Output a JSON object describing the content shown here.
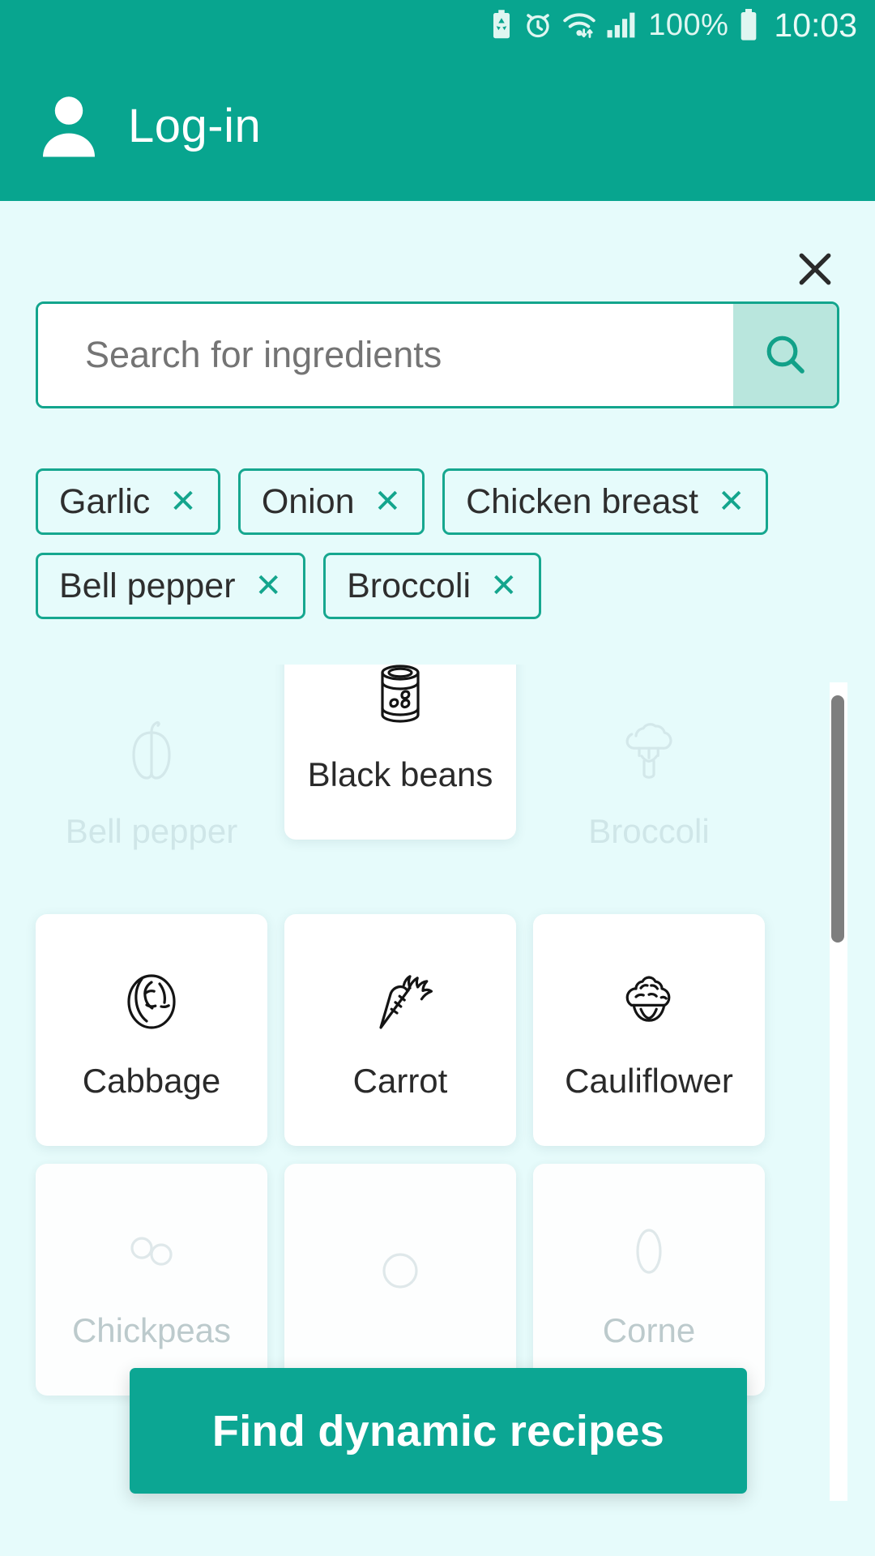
{
  "statusbar": {
    "icons": [
      "battery-saver-icon",
      "alarm-clock-icon",
      "wifi-icon",
      "signal-icon"
    ],
    "battery_percent": "100%",
    "battery_icon": "battery-full-icon",
    "time": "10:03"
  },
  "header": {
    "avatar_icon": "person-icon",
    "title": "Log-in",
    "background_color": "#08a58f"
  },
  "sheet": {
    "close_icon": "close-icon",
    "background_color": "#e6fbfb"
  },
  "search": {
    "placeholder": "Search for ingredients",
    "value": "",
    "button_icon": "search-icon",
    "button_color": "#b9e6dd",
    "border_color": "#13a58d"
  },
  "chips": [
    {
      "label": "Garlic",
      "remove_icon": "close-icon"
    },
    {
      "label": "Onion",
      "remove_icon": "close-icon"
    },
    {
      "label": "Chicken breast",
      "remove_icon": "close-icon"
    },
    {
      "label": "Bell pepper",
      "remove_icon": "close-icon"
    },
    {
      "label": "Broccoli",
      "remove_icon": "close-icon"
    }
  ],
  "grid": {
    "cards": [
      {
        "label": "Bell pepper",
        "icon": "bell-pepper-icon",
        "state": "disabled"
      },
      {
        "label": "Black beans",
        "icon": "can-of-beans-icon",
        "state": "active"
      },
      {
        "label": "Broccoli",
        "icon": "broccoli-icon",
        "state": "disabled"
      },
      {
        "label": "Cabbage",
        "icon": "cabbage-icon",
        "state": "active"
      },
      {
        "label": "Carrot",
        "icon": "carrot-icon",
        "state": "active"
      },
      {
        "label": "Cauliflower",
        "icon": "cauliflower-icon",
        "state": "active"
      },
      {
        "label": "Chickpeas",
        "icon": "chickpeas-icon",
        "state": "fade"
      },
      {
        "label": "",
        "icon": "ingredient-icon",
        "state": "fade"
      },
      {
        "label": "Corne",
        "icon": "corn-icon",
        "state": "fade"
      }
    ]
  },
  "scrollbar": {
    "name": "vertical-scrollbar",
    "thumb_color": "#7e7e7e"
  },
  "cta": {
    "label": "Find dynamic recipes",
    "color": "#0ca693"
  }
}
